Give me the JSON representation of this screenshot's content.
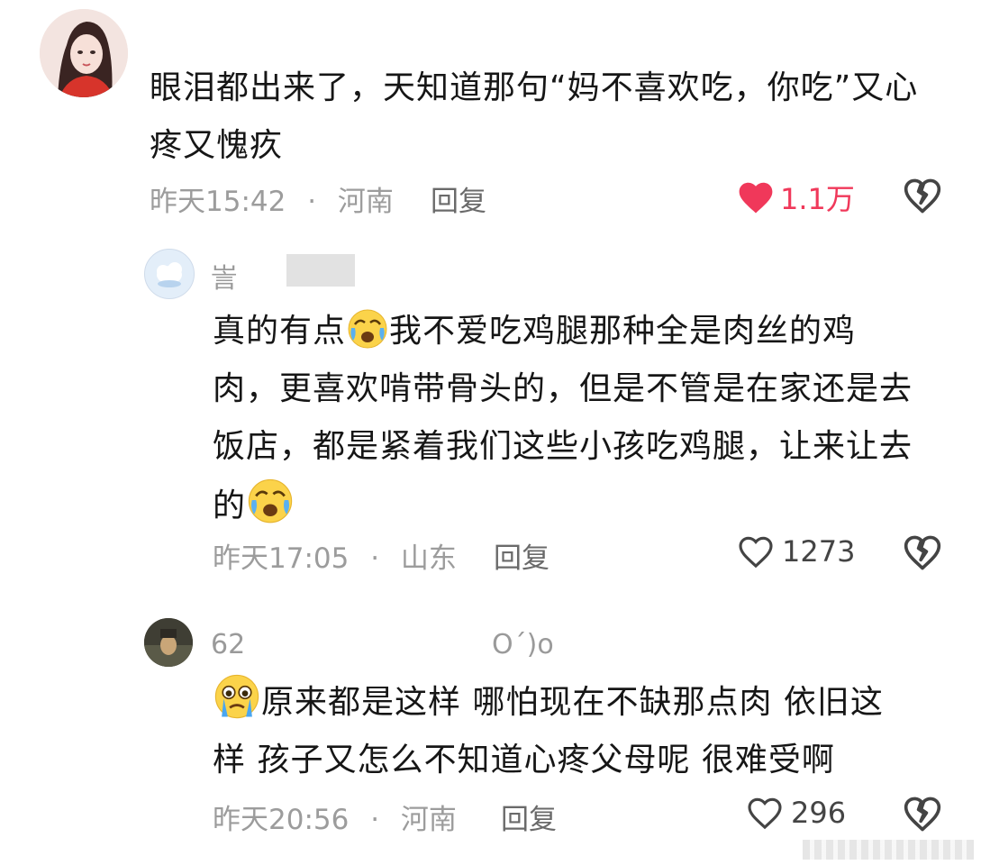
{
  "comments": [
    {
      "name": "",
      "text": [
        "眼泪都出来了，天知道那句“妈不喜欢吃，你吃”又心",
        "疼又愧疚"
      ],
      "time": "昨天15:42",
      "location": "河南",
      "reply_label": "回复",
      "likes": "1.1万",
      "liked": true
    },
    {
      "name": "訔",
      "text_lines": [
        {
          "before": "真的有点",
          "emoji": "crying-emoji",
          "after": "我不爱吃鸡腿那种全是肉丝的鸡"
        },
        {
          "before": "肉，更喜欢啃带骨头的，但是不管是在家还是去",
          "emoji": null,
          "after": ""
        },
        {
          "before": "饭店，都是紧着我们这些小孩吃鸡腿，让来让去",
          "emoji": null,
          "after": ""
        },
        {
          "before": "的",
          "emoji": "crying-emoji",
          "after": ""
        }
      ],
      "time": "昨天17:05",
      "location": "山东",
      "reply_label": "回复",
      "likes": "1273",
      "liked": false
    },
    {
      "name_start": "62",
      "name_end": "O´)o",
      "text_lines": [
        {
          "emoji": "tearful-emoji",
          "after": "原来都是这样 哪怕现在不缺那点肉 依旧这"
        },
        {
          "emoji": null,
          "after": "样  孩子又怎么不知道心疼父母呢 很难受啊"
        }
      ],
      "time": "昨天20:56",
      "location": "河南",
      "reply_label": "回复",
      "likes": "296",
      "liked": false
    }
  ],
  "separator": "·",
  "colors": {
    "like_active": "#f0385a",
    "meta": "#9c9c9c",
    "text": "#161616"
  }
}
